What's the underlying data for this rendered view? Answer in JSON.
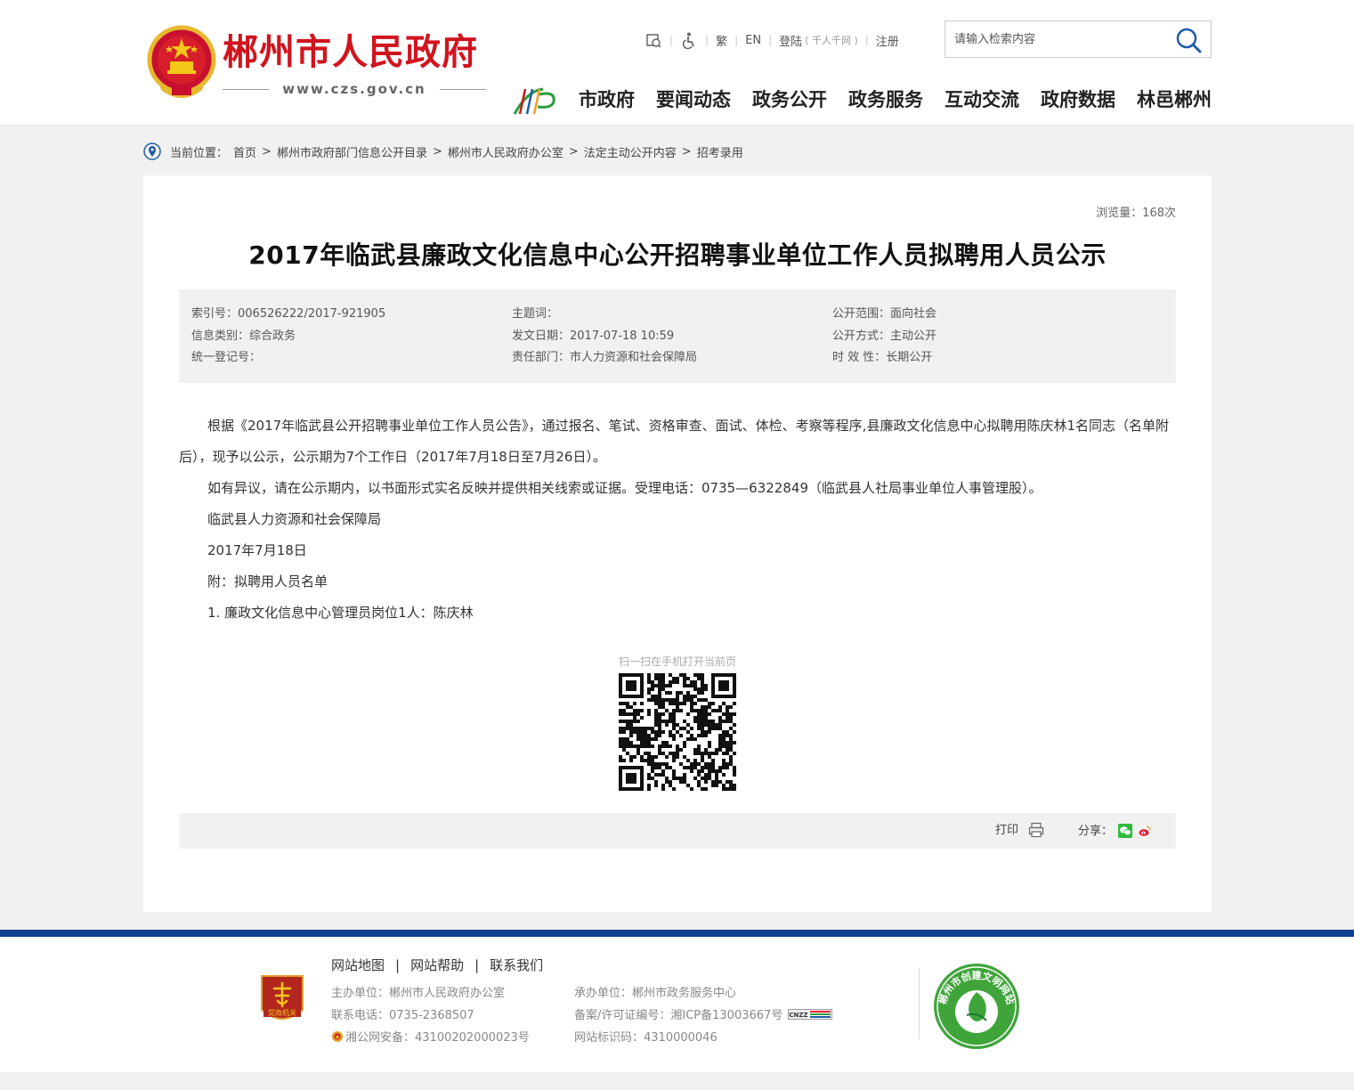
{
  "header": {
    "site_title": "郴州市人民政府",
    "site_url": "www.czs.gov.cn",
    "util": {
      "traditional": "繁",
      "english": "EN",
      "login": "登陆",
      "login_sub": "( 千人千网 )",
      "register": "注册"
    },
    "search_placeholder": "请输入检索内容",
    "nav": [
      "市政府",
      "要闻动态",
      "政务公开",
      "政务服务",
      "互动交流",
      "政府数据",
      "林邑郴州"
    ]
  },
  "breadcrumb": {
    "label": "当前位置：",
    "items": [
      "首页",
      "郴州市政府部门信息公开目录",
      "郴州市人民政府办公室",
      "法定主动公开内容",
      "招考录用"
    ]
  },
  "article": {
    "views": "浏览量：168次",
    "title": "2017年临武县廉政文化信息中心公开招聘事业单位工作人员拟聘用人员公示",
    "meta": {
      "index_no": "索引号：006526222/2017-921905",
      "keywords": "主题词：",
      "scope": "公开范围：面向社会",
      "category": "信息类别：综合政务",
      "pub_date": "发文日期：2017-07-18 10:59",
      "method": "公开方式：主动公开",
      "reg_no": "统一登记号：",
      "dept": "责任部门：市人力资源和社会保障局",
      "validity": "时 效 性：长期公开"
    },
    "paragraphs": [
      "根据《2017年临武县公开招聘事业单位工作人员公告》，通过报名、笔试、资格审查、面试、体检、考察等程序,县廉政文化信息中心拟聘用陈庆林1名同志（名单附后），现予以公示，公示期为7个工作日（2017年7月18日至7月26日）。",
      "如有异议，请在公示期内，以书面形式实名反映并提供相关线索或证据。受理电话：0735—6322849（临武县人社局事业单位人事管理股）。",
      "临武县人力资源和社会保障局",
      "2017年7月18日",
      "附：拟聘用人员名单",
      "1. 廉政文化信息中心管理员岗位1人：陈庆林"
    ],
    "qr_tip": "扫一扫在手机打开当前页",
    "print": "打印",
    "share": "分享："
  },
  "footer": {
    "links": [
      "网站地图",
      "网站帮助",
      "联系我们"
    ],
    "sponsor": "主办单位：郴州市人民政府办公室",
    "phone": "联系电话：0735-2368507",
    "police": "湘公网安备：43100202000023号",
    "organizer": "承办单位：郴州市政务服务中心",
    "icp": "备案/许可证编号：湘ICP备13003667号",
    "site_code": "网站标识码：4310000046",
    "party_badge_text": "党政机关",
    "civ_badge_text": "郴州市创建文明网站"
  },
  "colors": {
    "brand_red": "#d0141e",
    "footer_blue": "#0e3e8f",
    "light_bg": "#f1f1f1"
  }
}
